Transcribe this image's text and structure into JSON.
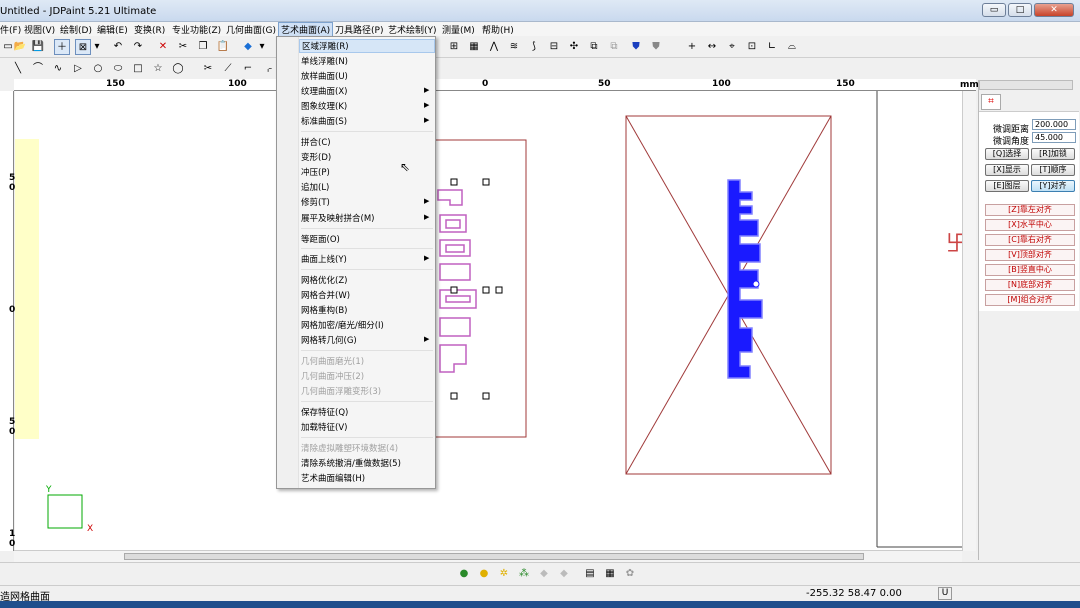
{
  "window": {
    "title": "Untitled - JDPaint 5.21 Ultimate",
    "minimize": "▭",
    "maximize": "□",
    "close": "✕"
  },
  "menubar": [
    {
      "label": "件(F)"
    },
    {
      "label": "视图(V)"
    },
    {
      "label": "绘制(D)"
    },
    {
      "label": "编辑(E)"
    },
    {
      "label": "变换(R)"
    },
    {
      "label": "专业功能(Z)"
    },
    {
      "label": "几何曲面(G)"
    },
    {
      "label": "艺术曲面(A)"
    },
    {
      "label": "刀具路径(P)"
    },
    {
      "label": "艺术绘制(Y)"
    },
    {
      "label": "测量(M)"
    },
    {
      "label": "帮助(H)"
    }
  ],
  "dropdown": {
    "items": [
      {
        "label": "区域浮雕(R)",
        "disabled": false,
        "submenu": false,
        "highlighted": true
      },
      {
        "label": "单线浮雕(N)",
        "disabled": false,
        "submenu": false
      },
      {
        "label": "放样曲面(U)",
        "disabled": false,
        "submenu": false
      },
      {
        "label": "纹理曲面(X)",
        "disabled": false,
        "submenu": true
      },
      {
        "label": "图象纹理(K)",
        "disabled": false,
        "submenu": true
      },
      {
        "label": "标准曲面(S)",
        "disabled": false,
        "submenu": true
      },
      {
        "label": "拼合(C)",
        "disabled": false,
        "submenu": false
      },
      {
        "label": "变形(D)",
        "disabled": false,
        "submenu": false
      },
      {
        "label": "冲压(P)",
        "disabled": false,
        "submenu": false
      },
      {
        "label": "追加(L)",
        "disabled": false,
        "submenu": false
      },
      {
        "label": "修剪(T)",
        "disabled": false,
        "submenu": true
      },
      {
        "label": "展平及映射拼合(M)",
        "disabled": false,
        "submenu": true
      },
      {
        "label": "等距面(O)",
        "disabled": false,
        "submenu": false
      },
      {
        "label": "曲面上线(Y)",
        "disabled": false,
        "submenu": true
      },
      {
        "label": "网格优化(Z)",
        "disabled": false,
        "submenu": false
      },
      {
        "label": "网格合并(W)",
        "disabled": false,
        "submenu": false
      },
      {
        "label": "网格重构(B)",
        "disabled": false,
        "submenu": false
      },
      {
        "label": "网格加密/磨光/细分(I)",
        "disabled": false,
        "submenu": false
      },
      {
        "label": "网格转几何(G)",
        "disabled": false,
        "submenu": true
      },
      {
        "label": "几何曲面磨光(1)",
        "disabled": true,
        "submenu": false
      },
      {
        "label": "几何曲面冲压(2)",
        "disabled": true,
        "submenu": false
      },
      {
        "label": "几何曲面浮雕变形(3)",
        "disabled": true,
        "submenu": false
      },
      {
        "label": "保存特征(Q)",
        "disabled": false,
        "submenu": false
      },
      {
        "label": "加载特征(V)",
        "disabled": false,
        "submenu": false
      },
      {
        "label": "清除虚拟雕塑环境数据(4)",
        "disabled": true,
        "submenu": false
      },
      {
        "label": "清除系统撤消/重做数据(5)",
        "disabled": false,
        "submenu": false
      },
      {
        "label": "艺术曲面编辑(H)",
        "disabled": false,
        "submenu": false
      }
    ]
  },
  "ruler": {
    "unit": "mm",
    "h_ticks": [
      "150",
      "100",
      "50",
      "0",
      "50",
      "100",
      "150"
    ],
    "v_ticks": [
      "5",
      "0",
      "0",
      "5",
      "0",
      "1",
      "0"
    ]
  },
  "panel": {
    "fine_distance_label": "微调距离",
    "fine_distance_value": "200.000",
    "fine_angle_label": "微调角度",
    "fine_angle_value": "45.000",
    "buttons": [
      "[Q]选择",
      "[R]加锁",
      "[X]显示",
      "[T]顺序",
      "[E]图层",
      "[Y]对齐"
    ],
    "align_buttons": [
      "[Z]靠左对齐",
      "[X]水平中心",
      "[C]靠右对齐",
      "[V]顶部对齐",
      "[B]竖直中心",
      "[N]底部对齐",
      "[M]组合对齐"
    ]
  },
  "status": {
    "message": "造网格曲面",
    "coordinates": "-255.32  58.47  0.00",
    "unit_indicator": "U"
  },
  "colors": {
    "accent": "#1a1aff",
    "frame": "#a03a3a",
    "text_outline": "#c060c0"
  }
}
